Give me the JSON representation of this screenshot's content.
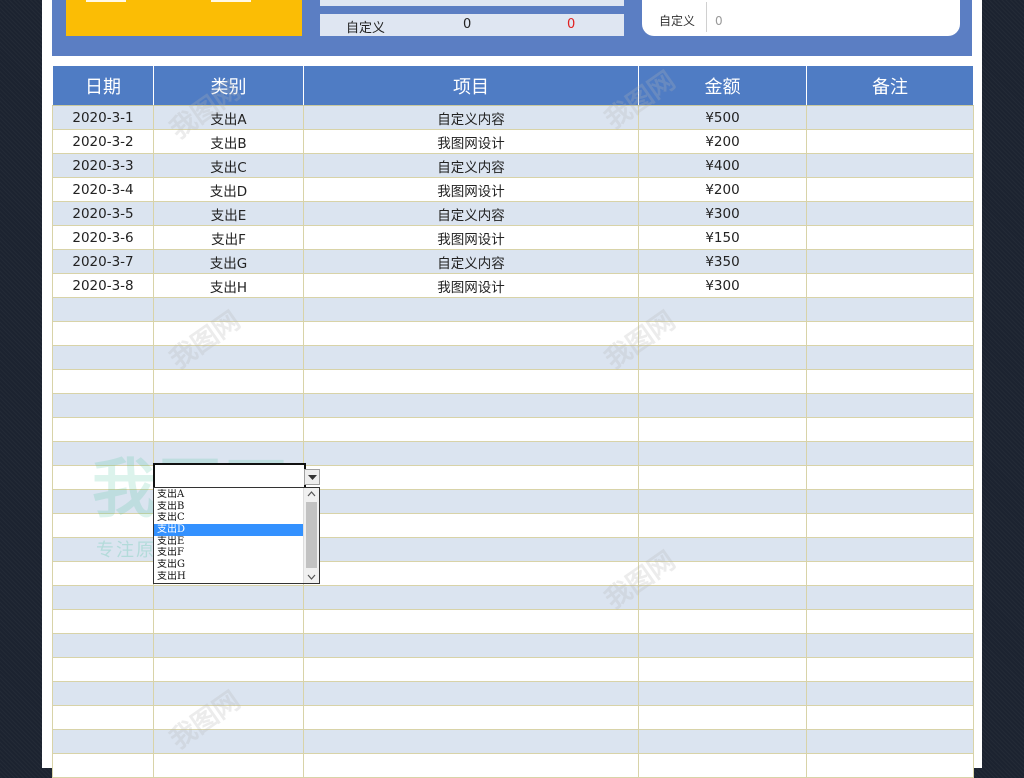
{
  "summary": {
    "mid_label": "自定义",
    "mid_value1": "0",
    "mid_value2": "0",
    "right_label": "自定义",
    "right_value": "0"
  },
  "table": {
    "headers": [
      "日期",
      "类别",
      "项目",
      "金额",
      "备注"
    ],
    "rows": [
      {
        "date": "2020-3-1",
        "category": "支出A",
        "item": "自定义内容",
        "amount": "¥500",
        "note": ""
      },
      {
        "date": "2020-3-2",
        "category": "支出B",
        "item": "我图网设计",
        "amount": "¥200",
        "note": ""
      },
      {
        "date": "2020-3-3",
        "category": "支出C",
        "item": "自定义内容",
        "amount": "¥400",
        "note": ""
      },
      {
        "date": "2020-3-4",
        "category": "支出D",
        "item": "我图网设计",
        "amount": "¥200",
        "note": ""
      },
      {
        "date": "2020-3-5",
        "category": "支出E",
        "item": "自定义内容",
        "amount": "¥300",
        "note": ""
      },
      {
        "date": "2020-3-6",
        "category": "支出F",
        "item": "我图网设计",
        "amount": "¥150",
        "note": ""
      },
      {
        "date": "2020-3-7",
        "category": "支出G",
        "item": "自定义内容",
        "amount": "¥350",
        "note": ""
      },
      {
        "date": "2020-3-8",
        "category": "支出H",
        "item": "我图网设计",
        "amount": "¥300",
        "note": ""
      }
    ],
    "empty_rows": 20
  },
  "dropdown": {
    "options": [
      "支出A",
      "支出B",
      "支出C",
      "支出D",
      "支出E",
      "支出F",
      "支出G",
      "支出H"
    ],
    "selected": "支出D",
    "selected_index": 3
  },
  "watermark": {
    "brand": "我图网",
    "slogan": "专注原创设计作品交易",
    "stamp": "我图网"
  },
  "colors": {
    "header_bg": "#4f7cc4",
    "banner_bg": "#5b7ec3",
    "accent_yellow": "#fbbd05",
    "row_alt": "#dbe4f0",
    "selection": "#3391ff",
    "negative_red": "#e02020"
  },
  "icons": {
    "dropdown_arrow": "chevron-down-icon",
    "scroll_up": "chevron-up-icon",
    "scroll_down": "chevron-down-icon"
  }
}
